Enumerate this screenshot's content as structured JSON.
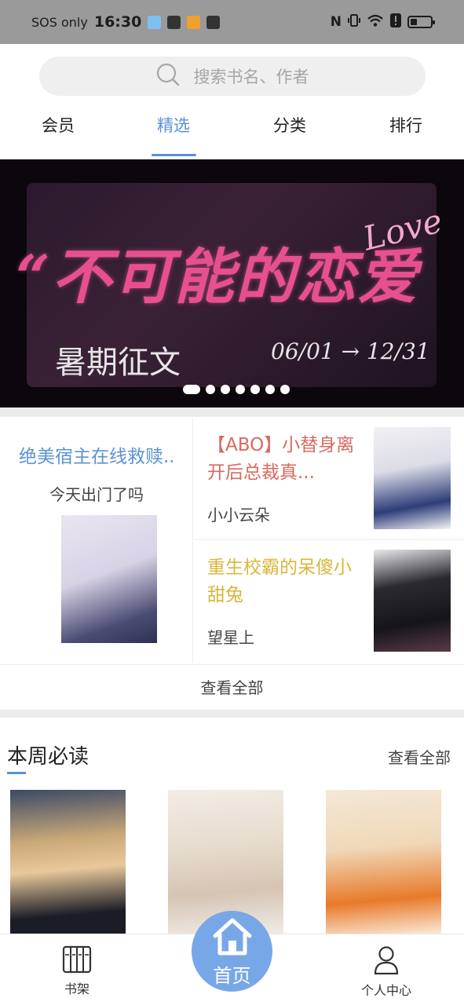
{
  "status_bar": {
    "carrier": "SOS only",
    "time": "16:30"
  },
  "search": {
    "placeholder": "搜索书名、作者"
  },
  "tabs": [
    {
      "label": "会员"
    },
    {
      "label": "精选",
      "active": true
    },
    {
      "label": "分类"
    },
    {
      "label": "排行"
    }
  ],
  "banner": {
    "title": "“不可能的恋爱",
    "subtitle": "暑期征文",
    "date_range": "06/01 → 12/31",
    "script_word": "Love"
  },
  "recommend": {
    "left": {
      "title": "绝美宿主在线救赎..",
      "author": "今天出门了吗"
    },
    "right": [
      {
        "title": "【ABO】小替身离开后总裁真...",
        "author": "小小云朵",
        "color": "#d9695f"
      },
      {
        "title": "重生校霸的呆傻小甜兔",
        "author": "望星上",
        "color": "#d9b63a"
      }
    ],
    "view_all": "查看全部"
  },
  "weekly": {
    "title": "本周必读",
    "more": "查看全部"
  },
  "bottom_nav": {
    "shelf": "书架",
    "home": "首页",
    "profile": "个人中心"
  }
}
